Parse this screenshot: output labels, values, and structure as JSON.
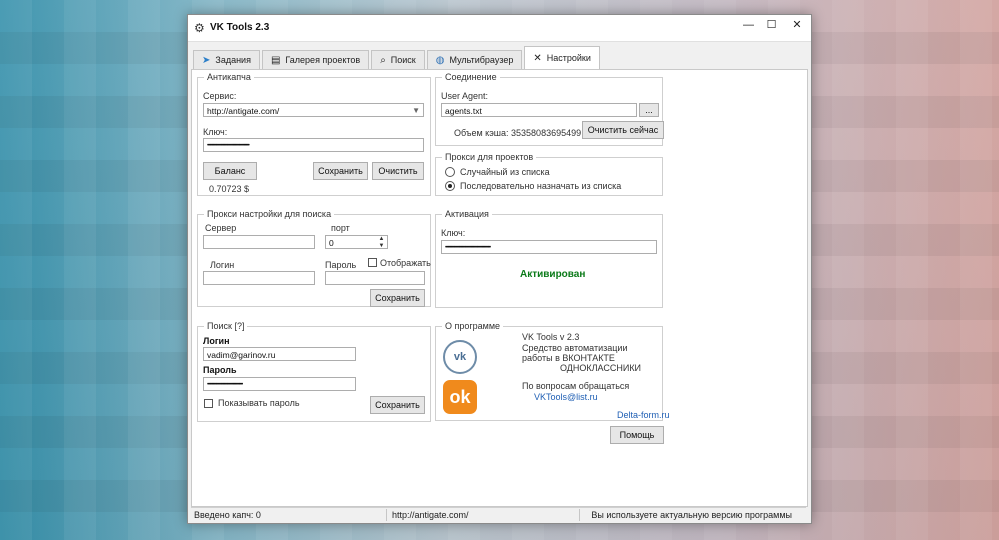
{
  "window": {
    "title": "VK Tools  2.3",
    "controls": {
      "minimize": "—",
      "maximize": "☐",
      "close": "✕"
    }
  },
  "tabs": [
    {
      "label": "Задания",
      "icon": "bird-icon"
    },
    {
      "label": "Галерея проектов",
      "icon": "gallery-icon"
    },
    {
      "label": "Поиск",
      "icon": "magnifier-icon"
    },
    {
      "label": "Мультибраузер",
      "icon": "globe-icon"
    },
    {
      "label": "Настройки",
      "icon": "tools-icon",
      "active": true
    }
  ],
  "anticaptcha": {
    "legend": "Антикапча",
    "service_label": "Сервис:",
    "service_value": "http://antigate.com/",
    "key_label": "Ключ:",
    "key_value": "••••••••••••••••••••••••••••••••••••••",
    "balance_button": "Баланс",
    "save_button": "Сохранить",
    "clear_button": "Очистить",
    "balance_value": "0.70723 $"
  },
  "connection": {
    "legend": "Соединение",
    "ua_label": "User Agent:",
    "ua_value": "agents.txt",
    "browse_button": "...",
    "cache_text": "Объем кэша: 35358083695499 кб",
    "clear_cache_button": "Очистить сейчас"
  },
  "project_proxy": {
    "legend": "Прокси для проектов",
    "option_random": "Случайный из списка",
    "option_sequential": "Последовательно назначать из списка"
  },
  "search_proxy": {
    "legend": "Прокси настройки для поиска",
    "server_label": "Сервер",
    "port_label": "порт",
    "port_value": "0",
    "login_label": "Логин",
    "password_label": "Пароль",
    "show_label": "Отображать",
    "save_button": "Сохранить"
  },
  "activation": {
    "legend": "Активация",
    "key_label": "Ключ:",
    "key_value": "•••••••••••••••••••••••••••••••••••••••••",
    "status": "Активирован"
  },
  "search": {
    "legend": "Поиск [?]",
    "login_label": "Логин",
    "login_value": "vadim@garinov.ru",
    "password_label": "Пароль",
    "password_value": "••••••••••••••••••••••••••••••••",
    "show_password_label": "Показывать пароль",
    "save_button": "Сохранить"
  },
  "about": {
    "legend": "О программе",
    "version": "VK Tools v 2.3",
    "desc_line1": "Средство автоматизации",
    "desc_line2": "работы в ВКОНТАКТЕ",
    "desc_line3": "ОДНОКЛАССНИКИ",
    "contact": "По вопросам обращаться",
    "email": "VKTools@list.ru",
    "site": "Delta-form.ru",
    "vk_logo": "vk",
    "ok_logo": "ok"
  },
  "help_button": "Помощь",
  "status": {
    "captchas": "Введено капч: 0",
    "service": "http://antigate.com/",
    "version_msg": "Вы используете актуальную версию программы"
  }
}
